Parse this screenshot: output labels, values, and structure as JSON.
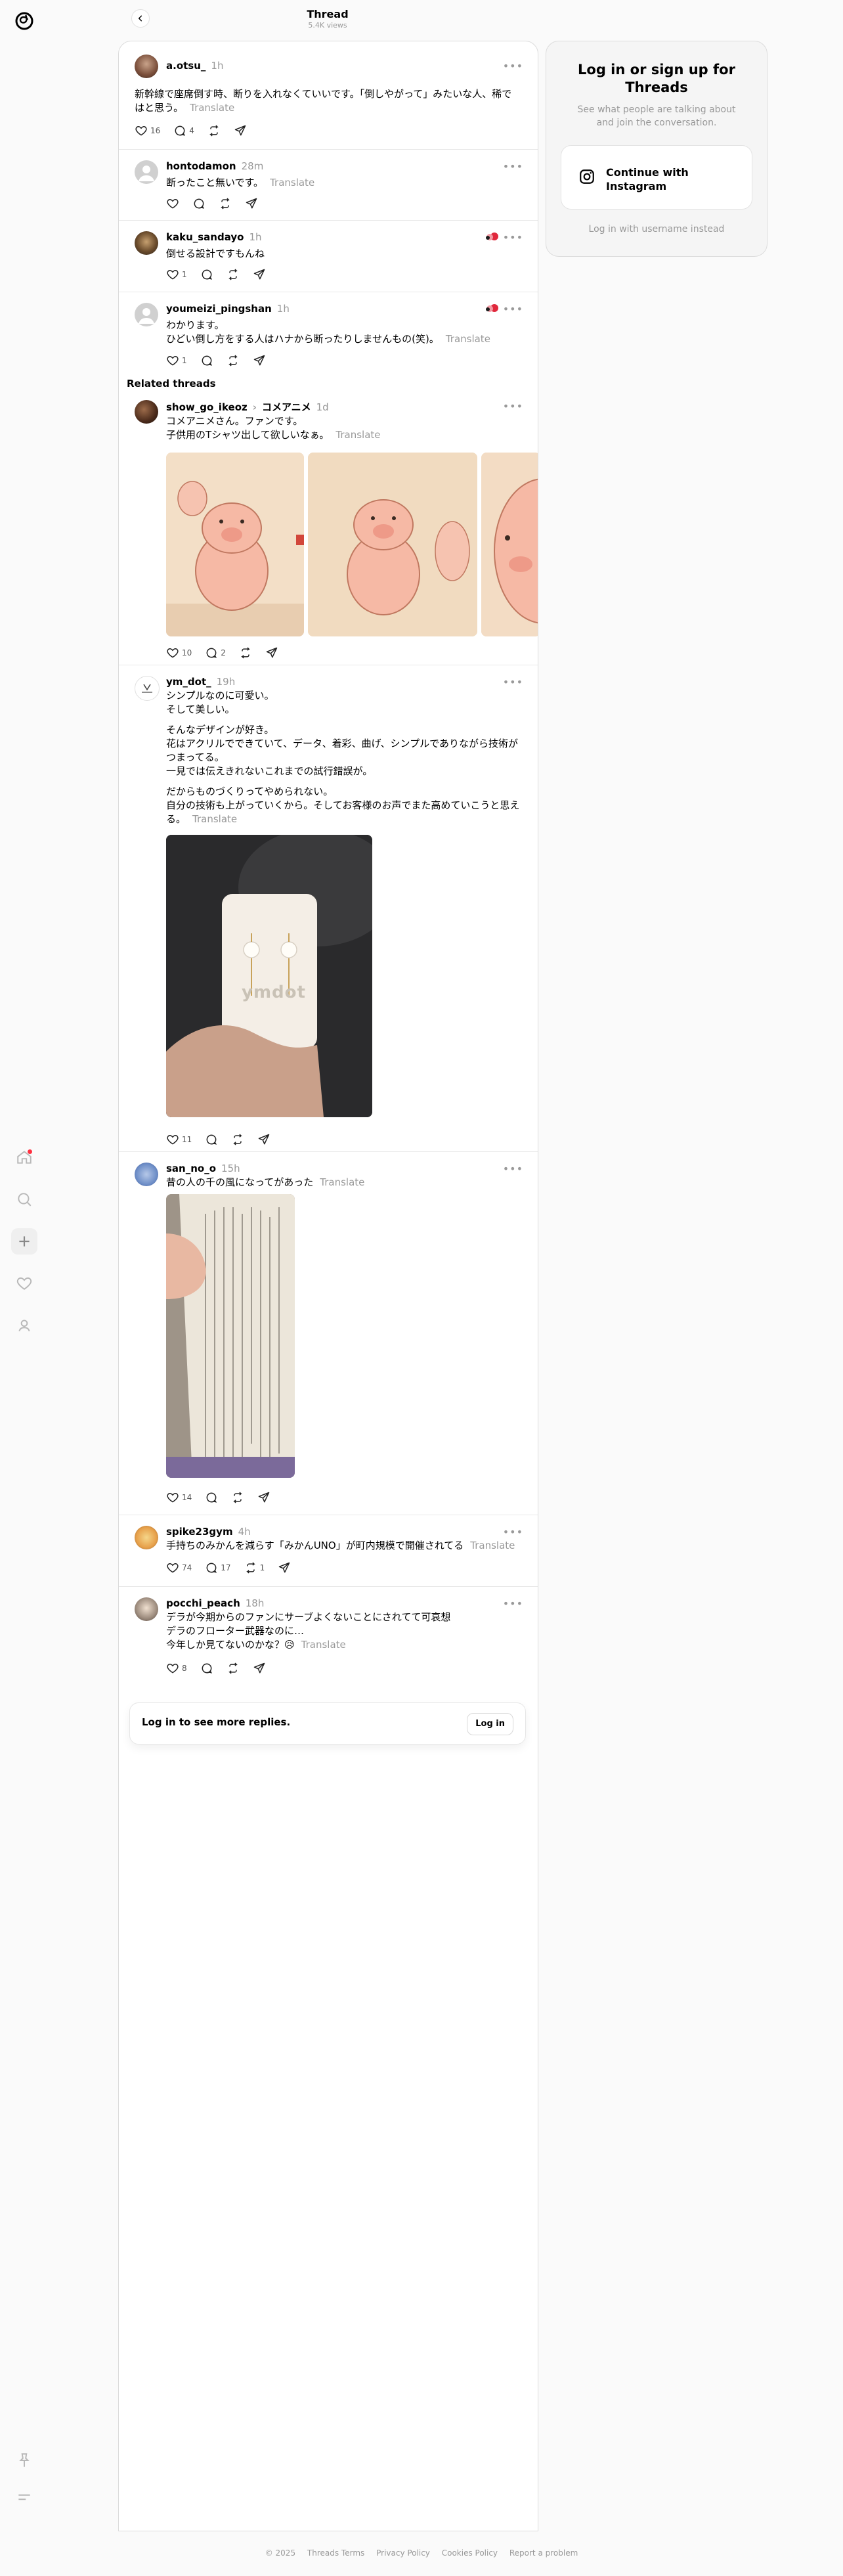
{
  "header": {
    "title": "Thread",
    "views": "5.4K views"
  },
  "main_post": {
    "username": "a.otsu_",
    "time": "1h",
    "text": "新幹線で座席倒す時、断りを入れなくていいです。「倒しやがって」みたいな人、稀ではと思う。",
    "translate": "Translate",
    "likes": "16",
    "replies": "4"
  },
  "replies": [
    {
      "username": "hontodamon",
      "time": "28m",
      "text": "断ったこと無いです。",
      "translate": "Translate"
    },
    {
      "username": "kaku_sandayo",
      "time": "1h",
      "text": "倒せる設計ですもんね",
      "likes": "1"
    },
    {
      "username": "youmeizi_pingshan",
      "time": "1h",
      "line1": "わかります。",
      "line2": "ひどい倒し方をする人はハナから断ったりしませんもの(笑)。",
      "translate": "Translate",
      "likes": "1"
    }
  ],
  "related": {
    "title": "Related threads",
    "posts": [
      {
        "username": "show_go_ikeoz",
        "sep": "›",
        "topic": "コメアニメ",
        "time": "1d",
        "line1": "コメアニメさん。ファンです。",
        "line2": "子供用のTシャツ出して欲しいなぁ。",
        "translate": "Translate",
        "likes": "10",
        "replies": "2"
      },
      {
        "username": "ym_dot_",
        "time": "19h",
        "p1": "シンプルなのに可愛い。",
        "p2": "そして美しい。",
        "p3": "そんなデザインが好き。",
        "p4": "花はアクリルでできていて、データ、着彩、曲げ、シンプルでありながら技術がつまってる。",
        "p5": "一見では伝えきれないこれまでの試行錯誤が。",
        "p6": "だからものづくりってやめられない。",
        "p7": "自分の技術も上がっていくから。そしてお客様のお声でまた高めていこうと思える。",
        "translate": "Translate",
        "card_logo": "ymdot",
        "likes": "11"
      },
      {
        "username": "san_no_o",
        "time": "15h",
        "text": "昔の人の千の風になってがあった",
        "translate": "Translate",
        "likes": "14"
      },
      {
        "username": "spike23gym",
        "time": "4h",
        "text": "手持ちのみかんを減らす「みかんUNO」が町内規模で開催されてる",
        "translate": "Translate",
        "likes": "74",
        "replies": "17",
        "reposts": "1"
      },
      {
        "username": "pocchi_peach",
        "time": "18h",
        "line1": "デラが今期からのファンにサーブよくないことにされてて可哀想",
        "line2": "デラのフローター武器なのに…",
        "line3": "今年しか見てないのかな？😥",
        "translate": "Translate",
        "likes": "8"
      }
    ]
  },
  "login_prompt": {
    "text": "Log in to see more replies.",
    "button": "Log in"
  },
  "sidebar_card": {
    "title": "Log in or sign up for Threads",
    "subtitle": "See what people are talking about and join the conversation.",
    "instagram_button": "Continue with Instagram",
    "alt_login": "Log in with username instead"
  },
  "footer": {
    "copyright": "© 2025",
    "links": [
      "Threads Terms",
      "Privacy Policy",
      "Cookies Policy",
      "Report a problem"
    ]
  },
  "icons": [
    "threads-logo-icon",
    "home-icon",
    "search-icon",
    "create-icon",
    "heart-icon",
    "profile-icon",
    "pin-icon",
    "menu-icon",
    "back-arrow-icon",
    "more-icon",
    "like-icon",
    "reply-icon",
    "repost-icon",
    "share-icon",
    "instagram-icon"
  ],
  "colors": {
    "notification": "#ff3040",
    "muted": "#999999"
  }
}
